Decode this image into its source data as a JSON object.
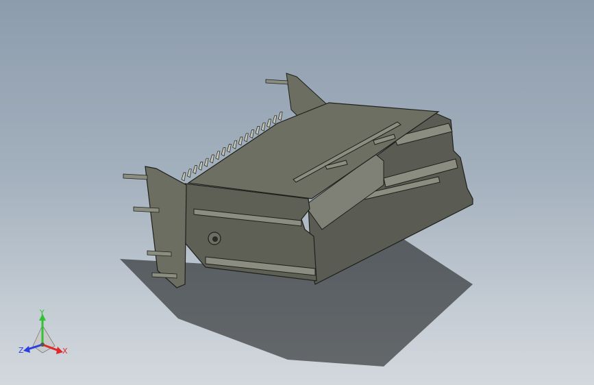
{
  "viewport": {
    "name": "3d-model-viewport",
    "background_top": "#8d9cad",
    "background_bottom": "#d3d8dd"
  },
  "model": {
    "name": "connector-cage-model",
    "body_color": "#5d5e54",
    "edge_color": "#1e1f1a",
    "highlight_color": "#8b8d80"
  },
  "triad": {
    "x_label": "X",
    "y_label": "Y",
    "z_label": "Z",
    "x_color": "#e0282a",
    "y_color": "#33c233",
    "z_color": "#2a3fe0"
  }
}
